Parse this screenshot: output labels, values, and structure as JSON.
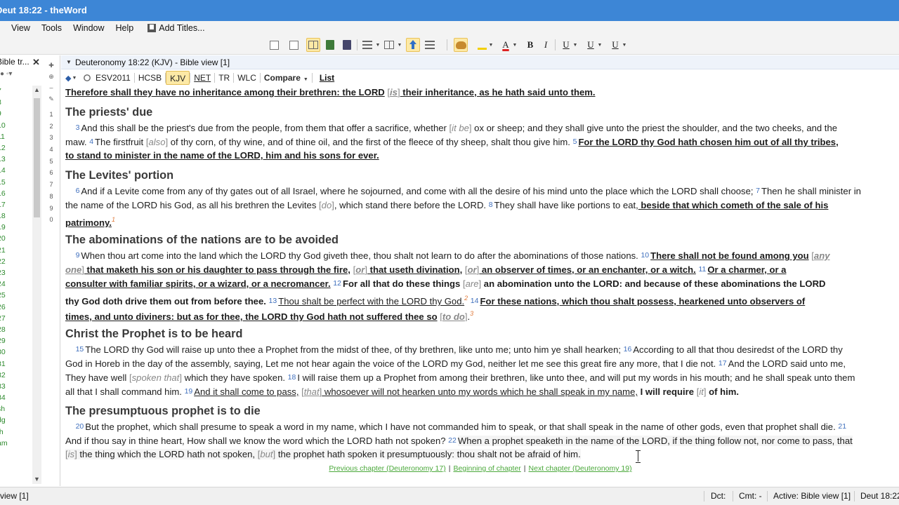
{
  "window": {
    "title": "Deut 18:22 - theWord"
  },
  "menu": {
    "view": "View",
    "tools": "Tools",
    "window": "Window",
    "help": "Help",
    "add_titles": "Add Titles..."
  },
  "left_pane": {
    "title": "Bible tr...",
    "tools": "● ◦▾",
    "items": [
      "7",
      "8",
      "9",
      "10",
      "11",
      "12",
      "13",
      "14",
      "15",
      "16",
      "17",
      "18",
      "19",
      "20",
      "21",
      "22",
      "23",
      "24",
      "25",
      "26",
      "27",
      "28",
      "29",
      "30",
      "31",
      "32",
      "33",
      "34",
      "sh",
      "dg",
      "th",
      "am"
    ],
    "vert_numbers": [
      "1",
      "2",
      "3",
      "4",
      "5",
      "6",
      "7",
      "8",
      "9",
      "0"
    ]
  },
  "bible_view": {
    "header": "Deuteronomy 18:22 (KJV)  -  Bible view [1]",
    "versions": [
      "ESV2011",
      "HCSB",
      "KJV",
      "NET",
      "TR",
      "WLC"
    ],
    "active_version": "KJV",
    "compare": "Compare",
    "list": "List"
  },
  "text": {
    "l0": "Therefore shall they have no inheritance among their brethren: the LORD",
    "l0b": "is",
    "l0c": " their inheritance, as he hath said unto them.",
    "h1": "The priests' due",
    "v3": "3",
    "l1": "And this shall be the priest's due from the people, from them that offer a sacrifice, whether",
    "l1b": "it be",
    "l1c": " ox or sheep; and they shall give unto the priest the shoulder, and the two cheeks, and the",
    "l2a": "maw.",
    "v4": "4",
    "l2b": "The firstfruit",
    "l2c": "also",
    "l2d": " of thy corn, of thy wine, and of thine oil, and the first of the fleece of thy sheep, shalt thou give him.",
    "v5": "5",
    "l2e": "For the LORD thy God hath chosen him out of all thy tribes,",
    "l3": "to stand to minister in the name of the LORD, him and his sons for ever.",
    "h2": "The Levites' portion",
    "v6": "6",
    "l4": "And if a Levite come from any of thy gates out of all Israel, where he sojourned, and come with all the desire of his mind unto the place which the LORD shall choose;",
    "v7": "7",
    "l4b": "Then he shall minister in",
    "l5": "the name of the LORD his God, as all his brethren the Levites",
    "l5b": "do",
    "l5c": ", which stand there before the LORD.",
    "v8": "8",
    "l5d": "They shall have like portions to eat,",
    "l5e": " beside that which cometh of the sale of his",
    "l6": "patrimony.",
    "fn1": "1",
    "h3": "The abominations of the nations are to be avoided",
    "v9": "9",
    "l7": "When thou art come into the land which the LORD thy God giveth thee, thou shalt not learn to do after the abominations of those nations.",
    "v10": "10",
    "l7b": "There shall not be found among you",
    "l7c": "any",
    "l8a": "one",
    "l8b": " that maketh his son or his daughter to pass through the fire,",
    "l8c": "or",
    "l8d": " that useth divination,",
    "l8e": "or",
    "l8f": " an observer of times, or an enchanter, or a witch.",
    "v11": "11",
    "l8g": "Or a charmer, or a",
    "l9": "consulter with familiar spirits, or a wizard, or a necromancer.",
    "v12": "12",
    "l9b": "For all that do these things",
    "l9c": "are",
    "l9d": " an abomination unto the LORD: and because of these abominations the LORD",
    "l10": "thy God doth drive them out from before thee.",
    "v13": "13",
    "l10b": "Thou shalt be perfect with the LORD thy God.",
    "fn2": "2",
    "v14": "14",
    "l10c": "For these nations, which thou shalt possess, hearkened unto observers of",
    "l11": "times, and unto diviners: but as for thee, the LORD thy God hath not suffered thee so",
    "l11b": "to do",
    "l11c": ".",
    "fn3": "3",
    "h4": "Christ the Prophet is to be heard",
    "v15": "15",
    "l12": "The LORD thy God will raise up unto thee a Prophet from the midst of thee, of thy brethren, like unto me; unto him ye shall hearken;",
    "v16": "16",
    "l12b": "According to all that thou desiredst of the LORD thy",
    "l13": "God in Horeb in the day of the assembly, saying, Let me not hear again the voice of the LORD my God, neither let me see this great fire any more, that I die not.",
    "v17": "17",
    "l13b": "And the LORD said unto me,",
    "l14": "They have well",
    "l14b": "spoken that",
    "l14c": " which they have spoken.",
    "v18": "18",
    "l14d": "I will raise them up a Prophet from among their brethren, like unto thee, and will put my words in his mouth; and he shall speak unto them",
    "l15": "all that I shall command him.",
    "v19": "19",
    "l15b": "And it shall come to pass,",
    "l15c": "that",
    "l15d": " whosoever will not hearken unto my words which he shall speak in my name,",
    "l15e": " I will require",
    "l15f": "it",
    "l15g": " of him.",
    "h5": "The presumptuous prophet is to die",
    "v20": "20",
    "l16": "But the prophet, which shall presume to speak a word in my name, which I have not commanded him to speak, or that shall speak in the name of other gods, even that prophet shall die.",
    "v21": "21",
    "l17": "And if thou say in thine heart, How shall we know the word which the LORD hath not spoken?",
    "v22": "22",
    "l17b": "When a prophet speaketh in the name of the LORD, if the thing follow not, nor come to pass, that",
    "l18a": "is",
    "l18b": " the thing which the LORD hath not spoken,",
    "l18c": "but",
    "l18d": " the prophet hath spoken it presumptuously: thou shalt not be afraid of him."
  },
  "nav": {
    "prev": "Previous chapter (Deuteronomy 17)",
    "begin": "Beginning of chapter",
    "next": "Next chapter (Deuteronomy 19)"
  },
  "status": {
    "left": "view [1]",
    "dct": "Dct:",
    "cmt": "Cmt: -",
    "active": "Active: Bible view [1]",
    "ref": "Deut 18:22"
  },
  "colors": {
    "title_bar": "#3d86d6",
    "verse_number": "#3f6fbd",
    "link_green": "#4aa83a",
    "highlight": "#fde9a6"
  }
}
